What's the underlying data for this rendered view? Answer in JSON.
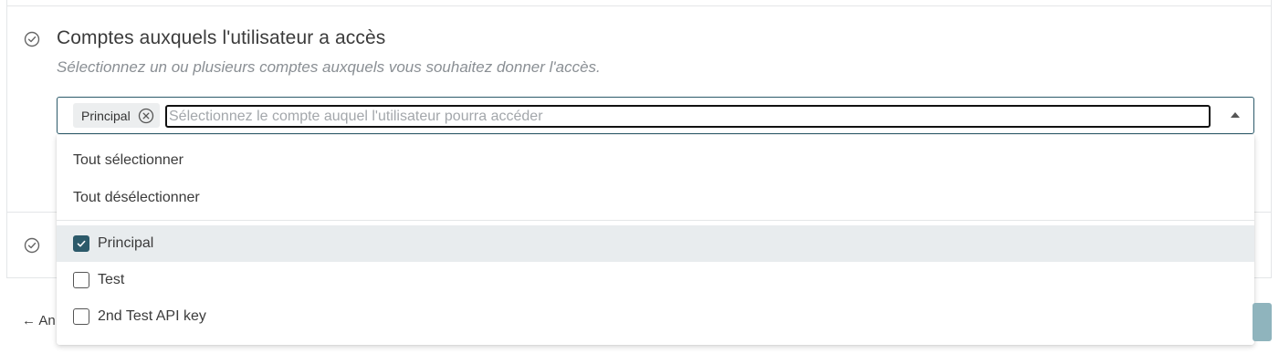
{
  "section": {
    "title": "Comptes auxquels l'utilisateur a accès",
    "subtitle": "Sélectionnez un ou plusieurs comptes auxquels vous souhaitez donner l'accès."
  },
  "select": {
    "chips": [
      {
        "label": "Principal"
      }
    ],
    "search_placeholder": "Sélectionnez le compte auquel l'utilisateur pourra accéder",
    "search_value": ""
  },
  "dropdown": {
    "select_all": "Tout sélectionner",
    "deselect_all": "Tout désélectionner",
    "options": [
      {
        "label": "Principal",
        "checked": true
      },
      {
        "label": "Test",
        "checked": false
      },
      {
        "label": "2nd Test API key",
        "checked": false
      }
    ]
  },
  "footer": {
    "back_label": "← An"
  },
  "colors": {
    "accent": "#2c5a6a",
    "selected_row": "#e8ecee",
    "chip_bg": "#eceeef",
    "disabled_button": "#8fb4bd"
  },
  "icons": {
    "section_status": "check-circle-icon",
    "chip_remove": "close-circle-icon",
    "dropdown_toggle": "caret-up-icon",
    "checkbox_checked": "checkmark-icon"
  }
}
